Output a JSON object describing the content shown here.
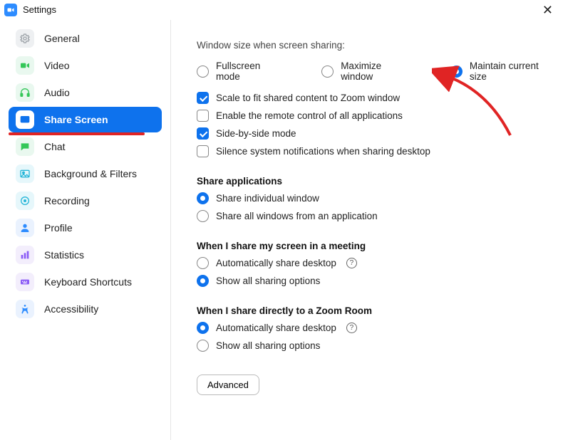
{
  "window": {
    "title": "Settings"
  },
  "sidebar": {
    "items": [
      {
        "label": "General"
      },
      {
        "label": "Video"
      },
      {
        "label": "Audio"
      },
      {
        "label": "Share Screen"
      },
      {
        "label": "Chat"
      },
      {
        "label": "Background & Filters"
      },
      {
        "label": "Recording"
      },
      {
        "label": "Profile"
      },
      {
        "label": "Statistics"
      },
      {
        "label": "Keyboard Shortcuts"
      },
      {
        "label": "Accessibility"
      }
    ]
  },
  "main": {
    "window_size_label": "Window size when screen sharing:",
    "window_size_options": {
      "fullscreen": "Fullscreen mode",
      "maximize": "Maximize window",
      "maintain": "Maintain current size"
    },
    "checks": {
      "scale": "Scale to fit shared content to Zoom window",
      "remote": "Enable the remote control of all applications",
      "sidebyside": "Side-by-side mode",
      "silence": "Silence system notifications when sharing desktop"
    },
    "share_apps_head": "Share applications",
    "share_apps": {
      "individual": "Share individual window",
      "all": "Share all windows from an application"
    },
    "share_meeting_head": "When I share my screen in a meeting",
    "share_meeting": {
      "auto": "Automatically share desktop",
      "showall": "Show all sharing options"
    },
    "share_room_head": "When I share directly to a Zoom Room",
    "share_room": {
      "auto": "Automatically share desktop",
      "showall": "Show all sharing options"
    },
    "advanced_label": "Advanced"
  }
}
